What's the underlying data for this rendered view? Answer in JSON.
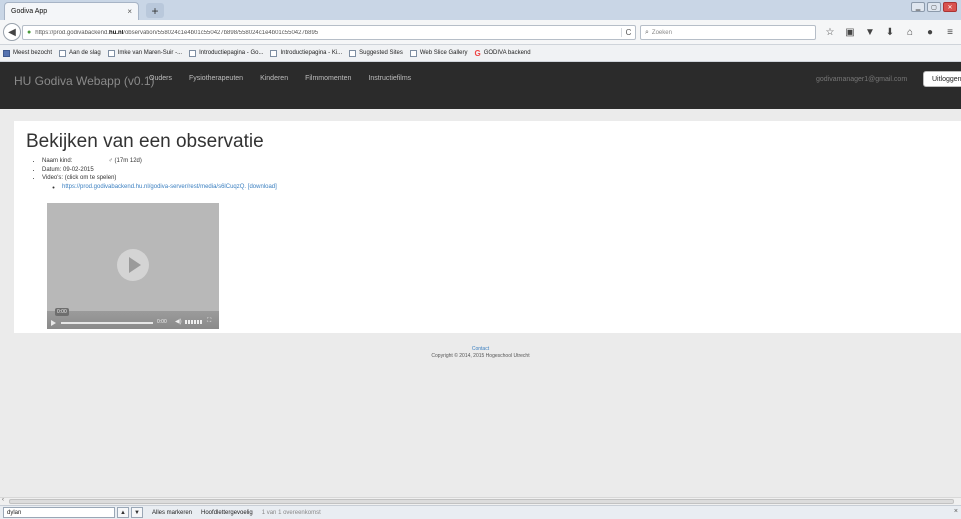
{
  "browser": {
    "tab_title": "Godiva App",
    "tab_close": "×",
    "new_tab": "+",
    "back": "◀",
    "url_prefix": "https://prod.godivabackend.",
    "url_host": "hu.nl",
    "url_path": "/observation/558024c1e4b01c550427b898/558024c1e4b01c550427b895",
    "reload": "C",
    "search_placeholder": "Zoeken",
    "toolbar_icons": [
      "star-icon",
      "reading-list-icon",
      "pocket-icon",
      "download-icon",
      "home-icon",
      "chat-icon",
      "menu-icon"
    ],
    "bookmarks": [
      {
        "label": "Meest bezocht",
        "icon": "star"
      },
      {
        "label": "Aan de slag",
        "icon": "page"
      },
      {
        "label": "Imke van Maren-Suir -...",
        "icon": "page"
      },
      {
        "label": "Introductiepagina - Go...",
        "icon": "page"
      },
      {
        "label": "Introductiepagina - Ki...",
        "icon": "page"
      },
      {
        "label": "Suggested Sites",
        "icon": "page"
      },
      {
        "label": "Web Slice Gallery",
        "icon": "page"
      },
      {
        "label": "GODIVA backend",
        "icon": "google"
      }
    ]
  },
  "app": {
    "brand": "HU Godiva Webapp (v0.1)",
    "nav": [
      "Ouders",
      "Fysiotherapeuten",
      "Kinderen",
      "Filmmomenten",
      "Instructiefilms"
    ],
    "user_email": "godivamanager1@gmail.com",
    "logout": "Uitloggen"
  },
  "observation": {
    "title": "Bekijken van een observatie",
    "child_label": "Naam kind:",
    "child_value": "♂ (17m 12d)",
    "date_label": "Datum:",
    "date_value": "09-02-2015",
    "videos_label": "Video's: (click om te spelen)",
    "video_url": "https://prod.godivabackend.hu.nl/godiva-server/rest/media/s6lCuqzQ.",
    "download_label": "[download]"
  },
  "player": {
    "tooltip_time": "0:00",
    "time": "0:00"
  },
  "footer": {
    "contact": "Contact",
    "copyright": "Copyright © 2014, 2015 Hogeschool Utrecht"
  },
  "findbar": {
    "query": "dylan",
    "highlight_all": "Alles markeren",
    "match_case": "Hoofdlettergevoelig",
    "status": "1 van 1 overeenkomst"
  }
}
